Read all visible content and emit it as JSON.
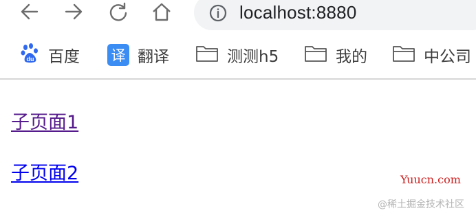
{
  "toolbar": {
    "back_icon": "arrow-left-icon",
    "forward_icon": "arrow-right-icon",
    "reload_icon": "reload-icon",
    "home_icon": "home-icon"
  },
  "omnibox": {
    "info_icon": "info-icon",
    "url": "localhost:8880"
  },
  "bookmarks": {
    "items": [
      {
        "label": "百度",
        "icon": "baidu-paw-icon"
      },
      {
        "label": "翻译",
        "icon": "translate-icon",
        "badge": "译"
      },
      {
        "label": "测测h5",
        "icon": "folder-icon"
      },
      {
        "label": "我的",
        "icon": "folder-icon"
      },
      {
        "label": "中公司",
        "icon": "folder-icon"
      }
    ]
  },
  "content": {
    "links": [
      {
        "label": "子页面1",
        "state": "visited",
        "color": "#551a8b"
      },
      {
        "label": "子页面2",
        "state": "unvisited",
        "color": "#0000ee"
      }
    ]
  },
  "watermarks": {
    "yuucn": "Yuucn.com",
    "juejin": "@稀土掘金技术社区"
  },
  "colors": {
    "baidu_blue": "#3069ee",
    "fanyi_blue": "#3b8cf3",
    "omnibox_bg": "#f1f3f4",
    "yuucn_red": "#cc1f1f"
  }
}
